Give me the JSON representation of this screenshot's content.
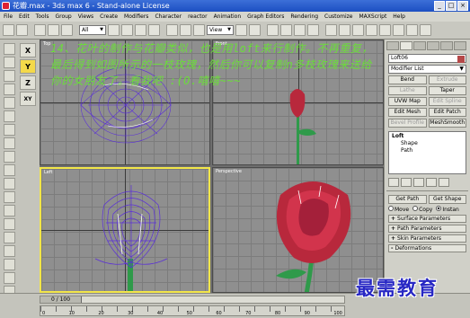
{
  "window": {
    "title": "花瓣.max - 3ds max 6 - Stand-alone License",
    "min": "_",
    "max": "□",
    "close": "×"
  },
  "menubar": [
    "File",
    "Edit",
    "Tools",
    "Group",
    "Views",
    "Create",
    "Modifiers",
    "Character",
    "reactor",
    "Animation",
    "Graph Editors",
    "Rendering",
    "Customize",
    "MAXScript",
    "Help"
  ],
  "toolbar": {
    "selection_filter": "All",
    "ref_coord": "View"
  },
  "axes": [
    "X",
    "Y",
    "Z",
    "XY"
  ],
  "viewports": {
    "top": {
      "label": "Top"
    },
    "front": {
      "label": "Front"
    },
    "left": {
      "label": "Left"
    },
    "perspective": {
      "label": "Perspective"
    }
  },
  "overlay_text": "14、花叶的制作与花瓣类似，也是用loft来行制作。不再重复，最后得到如图所示的一枝玫瑰，然后你可以复制n多枝玫瑰来送给你的女朋友了。看我吧 :(O.嘻嘻~~~",
  "command_panel": {
    "object_name": "Loft06",
    "modifier_list": "Modifier List",
    "modifier_buttons": [
      {
        "label": "Bend",
        "enabled": true
      },
      {
        "label": "Extrude",
        "enabled": false
      },
      {
        "label": "Lathe",
        "enabled": false
      },
      {
        "label": "Taper",
        "enabled": true
      },
      {
        "label": "UVW Map",
        "enabled": true
      },
      {
        "label": "Edit Spline",
        "enabled": false
      },
      {
        "label": "Edit Mesh",
        "enabled": true
      },
      {
        "label": "Edit Patch",
        "enabled": true
      },
      {
        "label": "Bevel Profile",
        "enabled": false
      },
      {
        "label": "MeshSmooth",
        "enabled": true
      }
    ],
    "stack": {
      "root": "Loft",
      "children": [
        "Shape",
        "Path"
      ]
    },
    "get_path": "Get Path",
    "get_shape": "Get Shape",
    "radio_move": "Move",
    "radio_copy": "Copy",
    "radio_instance": "Instan",
    "rollouts": [
      {
        "sign": "+",
        "label": "Surface Parameters"
      },
      {
        "sign": "+",
        "label": "Path Parameters"
      },
      {
        "sign": "+",
        "label": "Skin Parameters"
      },
      {
        "sign": "-",
        "label": "Deformations"
      }
    ]
  },
  "timeline": {
    "position": "0 / 100",
    "ticks": [
      "0",
      "10",
      "20",
      "30",
      "40",
      "50",
      "60",
      "70",
      "80",
      "90",
      "100"
    ]
  },
  "watermark": "最需教育",
  "colors": {
    "overlay_text": "#6bdd3a",
    "rose_petal": "#b8283c",
    "wireframe": "#5a2fd8",
    "stem": "#2f9a4a",
    "watermark": "#2727c4"
  }
}
